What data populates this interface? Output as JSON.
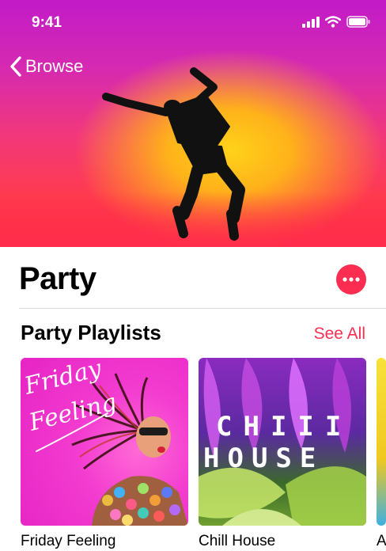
{
  "status_bar": {
    "time": "9:41"
  },
  "nav": {
    "back_label": "Browse"
  },
  "page": {
    "title": "Party"
  },
  "section": {
    "title": "Party Playlists",
    "see_all_label": "See All"
  },
  "playlists": [
    {
      "name": "Friday Feeling",
      "art_text": "Friday Feeling"
    },
    {
      "name": "Chill House",
      "art_text_line1": "CHIII",
      "art_text_line2": "HOUSE"
    },
    {
      "name": "A"
    }
  ],
  "colors": {
    "accent": "#fb2e52"
  }
}
